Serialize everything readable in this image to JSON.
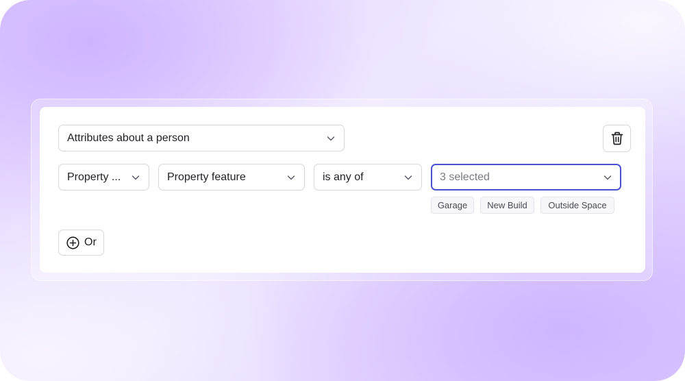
{
  "filter": {
    "category_select": {
      "value": "Attributes about a person",
      "icon": "chevron-down-icon"
    },
    "delete_button": {
      "icon": "trash-icon"
    },
    "field_select": {
      "value": "Property ...",
      "icon": "chevron-down-icon"
    },
    "attribute_select": {
      "value": "Property feature",
      "icon": "chevron-down-icon"
    },
    "operator_select": {
      "value": "is any of",
      "icon": "chevron-down-icon"
    },
    "values_select": {
      "value": "3 selected",
      "icon": "chevron-down-icon",
      "focused": true
    },
    "selected_values": [
      "Garage",
      "New Build",
      "Outside Space"
    ]
  },
  "actions": {
    "or_button": {
      "label": "Or",
      "icon": "plus-circle-icon"
    }
  },
  "colors": {
    "focus_border": "#4a52d1",
    "background_accent": "#d9c6ff"
  }
}
